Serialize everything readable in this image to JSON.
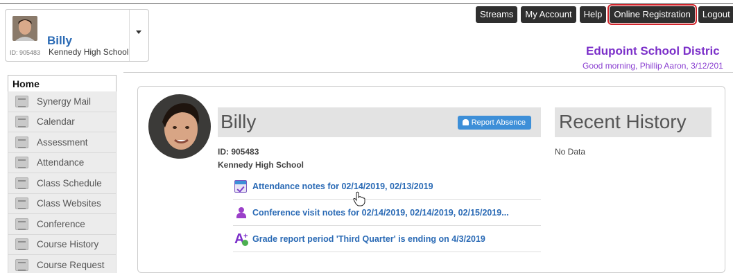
{
  "student_card": {
    "name": "Billy",
    "id_label": "ID: 905483",
    "school": "Kennedy High School"
  },
  "top_nav": [
    {
      "label": "Streams"
    },
    {
      "label": "My Account"
    },
    {
      "label": "Help"
    },
    {
      "label": "Online Registration",
      "highlighted": true
    },
    {
      "label": "Logout"
    }
  ],
  "header": {
    "district": "Edupoint School Distric",
    "greeting": "Good morning, Phillip Aaron, 3/12/201"
  },
  "sidebar": {
    "home_label": "Home",
    "items": [
      {
        "label": "Synergy Mail",
        "icon": "mail-icon"
      },
      {
        "label": "Calendar",
        "icon": "calendar-icon"
      },
      {
        "label": "Assessment",
        "icon": "assessment-icon"
      },
      {
        "label": "Attendance",
        "icon": "attendance-icon"
      },
      {
        "label": "Class Schedule",
        "icon": "schedule-icon"
      },
      {
        "label": "Class Websites",
        "icon": "websites-icon"
      },
      {
        "label": "Conference",
        "icon": "conference-icon"
      },
      {
        "label": "Course History",
        "icon": "history-icon"
      },
      {
        "label": "Course Request",
        "icon": "request-icon"
      }
    ]
  },
  "student": {
    "name": "Billy",
    "report_absence_label": "Report Absence",
    "id_line": "ID: 905483",
    "school_line": "Kennedy High School"
  },
  "notes": [
    {
      "text": "Attendance notes for 02/14/2019, 02/13/2019",
      "icon": "attendance-note-icon"
    },
    {
      "text": "Conference visit notes for 02/14/2019, 02/14/2019, 02/15/2019...",
      "icon": "conference-note-icon"
    },
    {
      "text": "Grade report period 'Third Quarter' is ending on 4/3/2019",
      "icon": "grade-report-icon"
    }
  ],
  "recent_history": {
    "title": "Recent History",
    "empty_text": "No Data"
  },
  "colors": {
    "accent_blue": "#2a6ab5",
    "district_purple": "#7b2fc9",
    "highlight_red": "#d0242b",
    "button_blue": "#3d8fd8"
  }
}
